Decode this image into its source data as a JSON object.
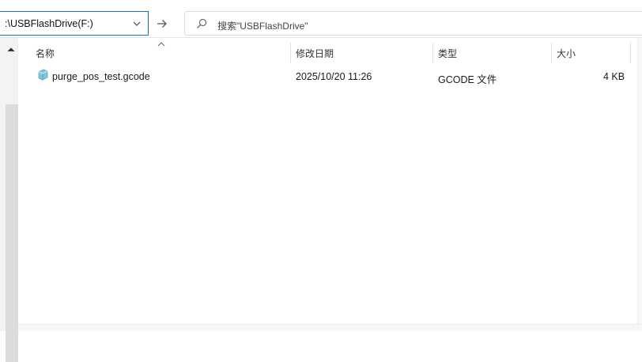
{
  "address": {
    "path": ":\\USBFlashDrive(F:)"
  },
  "search": {
    "placeholder": "搜索\"USBFlashDrive\""
  },
  "columns": {
    "name": "名称",
    "modified": "修改日期",
    "type": "类型",
    "size": "大小"
  },
  "files": [
    {
      "name": "purge_pos_test.gcode",
      "modified": "2025/10/20 11:26",
      "type": "GCODE 文件",
      "size": "4 KB"
    }
  ],
  "icons": {
    "address_dropdown": "chevron-down-icon",
    "go": "arrow-right-icon",
    "search": "search-icon",
    "file": "gcode-file-icon",
    "scroll_up": "chevron-up-icon",
    "sort": "sort-ascending-icon"
  },
  "colors": {
    "address_border": "#1a73c8"
  }
}
